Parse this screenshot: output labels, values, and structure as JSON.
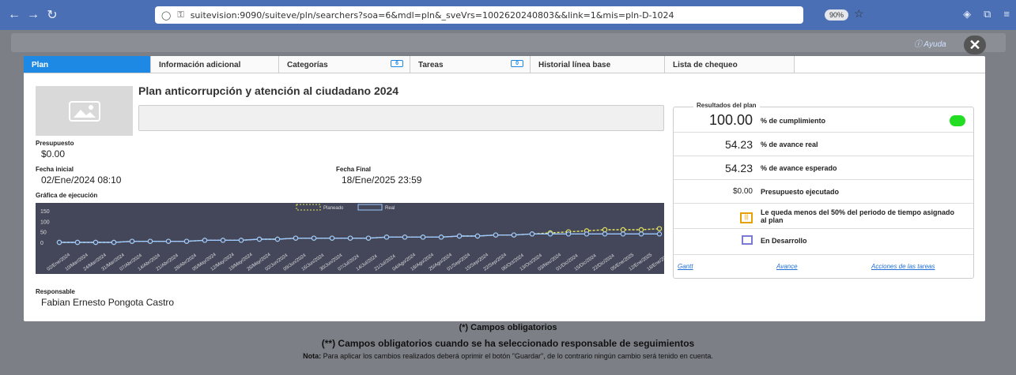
{
  "browser": {
    "url": "suitevision:9090/suiteve/pln/searchers?soa=6&mdl=pln&_sveVrs=1002620240803&&link=1&mis=pln-D-1024",
    "zoom": "90%"
  },
  "header": {
    "help_label": "Ayuda",
    "close_label": "✕"
  },
  "tabs": [
    {
      "label": "Plan"
    },
    {
      "label": "Información adicional"
    },
    {
      "label": "Categorías",
      "count": "6"
    },
    {
      "label": "Tareas",
      "count": "0"
    },
    {
      "label": "Historial línea base"
    },
    {
      "label": "Lista de chequeo"
    }
  ],
  "plan": {
    "title": "Plan anticorrupción y atención al ciudadano 2024",
    "budget_label": "Presupuesto",
    "budget_value": "$0.00",
    "start_label": "Fecha inicial",
    "start_value": "02/Ene/2024 08:10",
    "end_label": "Fecha Final",
    "end_value": "18/Ene/2025 23:59",
    "chart_label": "Gráfica de ejecución",
    "responsible_label": "Responsable",
    "responsible_value": "Fabian Ernesto Pongota Castro"
  },
  "chart_data": {
    "type": "line",
    "legend": [
      "Planeado",
      "Real"
    ],
    "yticks": [
      "150",
      "100",
      "50",
      "0"
    ],
    "categories": [
      "02/Ene/2024",
      "10/Mar/2024",
      "24/Mar/2024",
      "31/Mar/2024",
      "07/Abr/2024",
      "14/Abr/2024",
      "21/Abr/2024",
      "28/Abr/2024",
      "05/May/2024",
      "12/May/2024",
      "19/May/2024",
      "26/May/2024",
      "02/Jun/2024",
      "09/Jun/2024",
      "16/Jun/2024",
      "30/Jun/2024",
      "07/Jul/2024",
      "14/Jul/2024",
      "21/Jul/2024",
      "04/Ago/2024",
      "18/Ago/2024",
      "25/Ago/2024",
      "01/Sep/2024",
      "15/Sep/2024",
      "22/Sep/2024",
      "06/Oct/2024",
      "13/Oct/2024",
      "03/Nov/2024",
      "01/Dic/2024",
      "15/Dic/2024",
      "22/Dic/2024",
      "05/Ene/2025",
      "12/Ene/2025",
      "18/Ene/2025"
    ],
    "series": [
      {
        "name": "Planeado",
        "values": [
          0,
          0,
          0,
          0,
          5,
          5,
          5,
          5,
          10,
          10,
          10,
          15,
          15,
          20,
          20,
          20,
          20,
          20,
          25,
          25,
          25,
          25,
          30,
          30,
          35,
          35,
          40,
          45,
          50,
          55,
          60,
          60,
          60,
          65
        ]
      },
      {
        "name": "Real",
        "values": [
          0,
          0,
          0,
          0,
          5,
          5,
          5,
          5,
          10,
          10,
          10,
          15,
          15,
          20,
          20,
          20,
          20,
          20,
          25,
          25,
          25,
          25,
          30,
          30,
          35,
          35,
          40,
          40,
          40,
          40,
          40,
          40,
          40,
          40
        ]
      }
    ],
    "ylim": [
      0,
      150
    ]
  },
  "results": {
    "legend": "Resultados del plan",
    "rows": [
      {
        "value": "100.00",
        "label": "% de cumplimiento"
      },
      {
        "value": "54.23",
        "label": "% de avance real"
      },
      {
        "value": "54.23",
        "label": "% de avance esperado"
      },
      {
        "value": "$0.00",
        "label": "Presupuesto ejecutado"
      },
      {
        "value": "",
        "label": "Le queda menos del 50% del periodo de tiempo asignado al plan"
      },
      {
        "value": "",
        "label": "En Desarrollo"
      }
    ],
    "status_color": "#22dd22",
    "links": {
      "gantt": "Gantt",
      "avance": "Avance",
      "acciones": "Acciones de las tareas"
    }
  },
  "footer": {
    "required": "(*) Campos obligatorios",
    "required2": "(**) Campos obligatorios cuando se ha seleccionado responsable de seguimientos",
    "note_label": "Nota:",
    "note_text": " Para aplicar los cambios realizados deberá oprimir el botón \"Guardar\", de lo contrario ningún cambio será tenido en cuenta."
  }
}
